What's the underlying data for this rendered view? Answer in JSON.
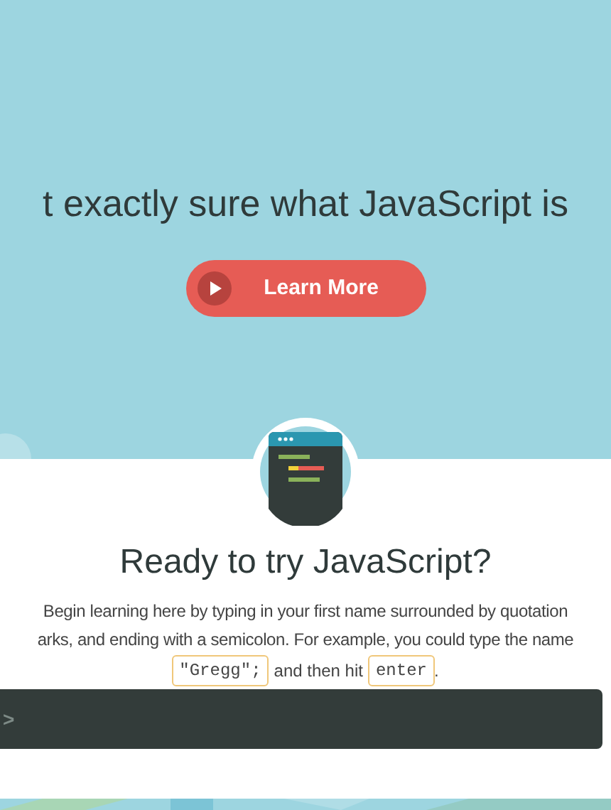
{
  "hero": {
    "headline": "t exactly sure what JavaScript is",
    "button": {
      "label": "Learn More"
    }
  },
  "try_it": {
    "heading": "Ready to try JavaScript?",
    "instruction_lines": [
      "Begin learning here by typing in your first name surrounded by quotation",
      "arks, and ending with a semicolon. For example, you could type the name"
    ],
    "example_code": "\"Gregg\";",
    "middle_text": "and then hit",
    "key": "enter",
    "end_text": ".",
    "console": {
      "prompt": ">"
    }
  }
}
